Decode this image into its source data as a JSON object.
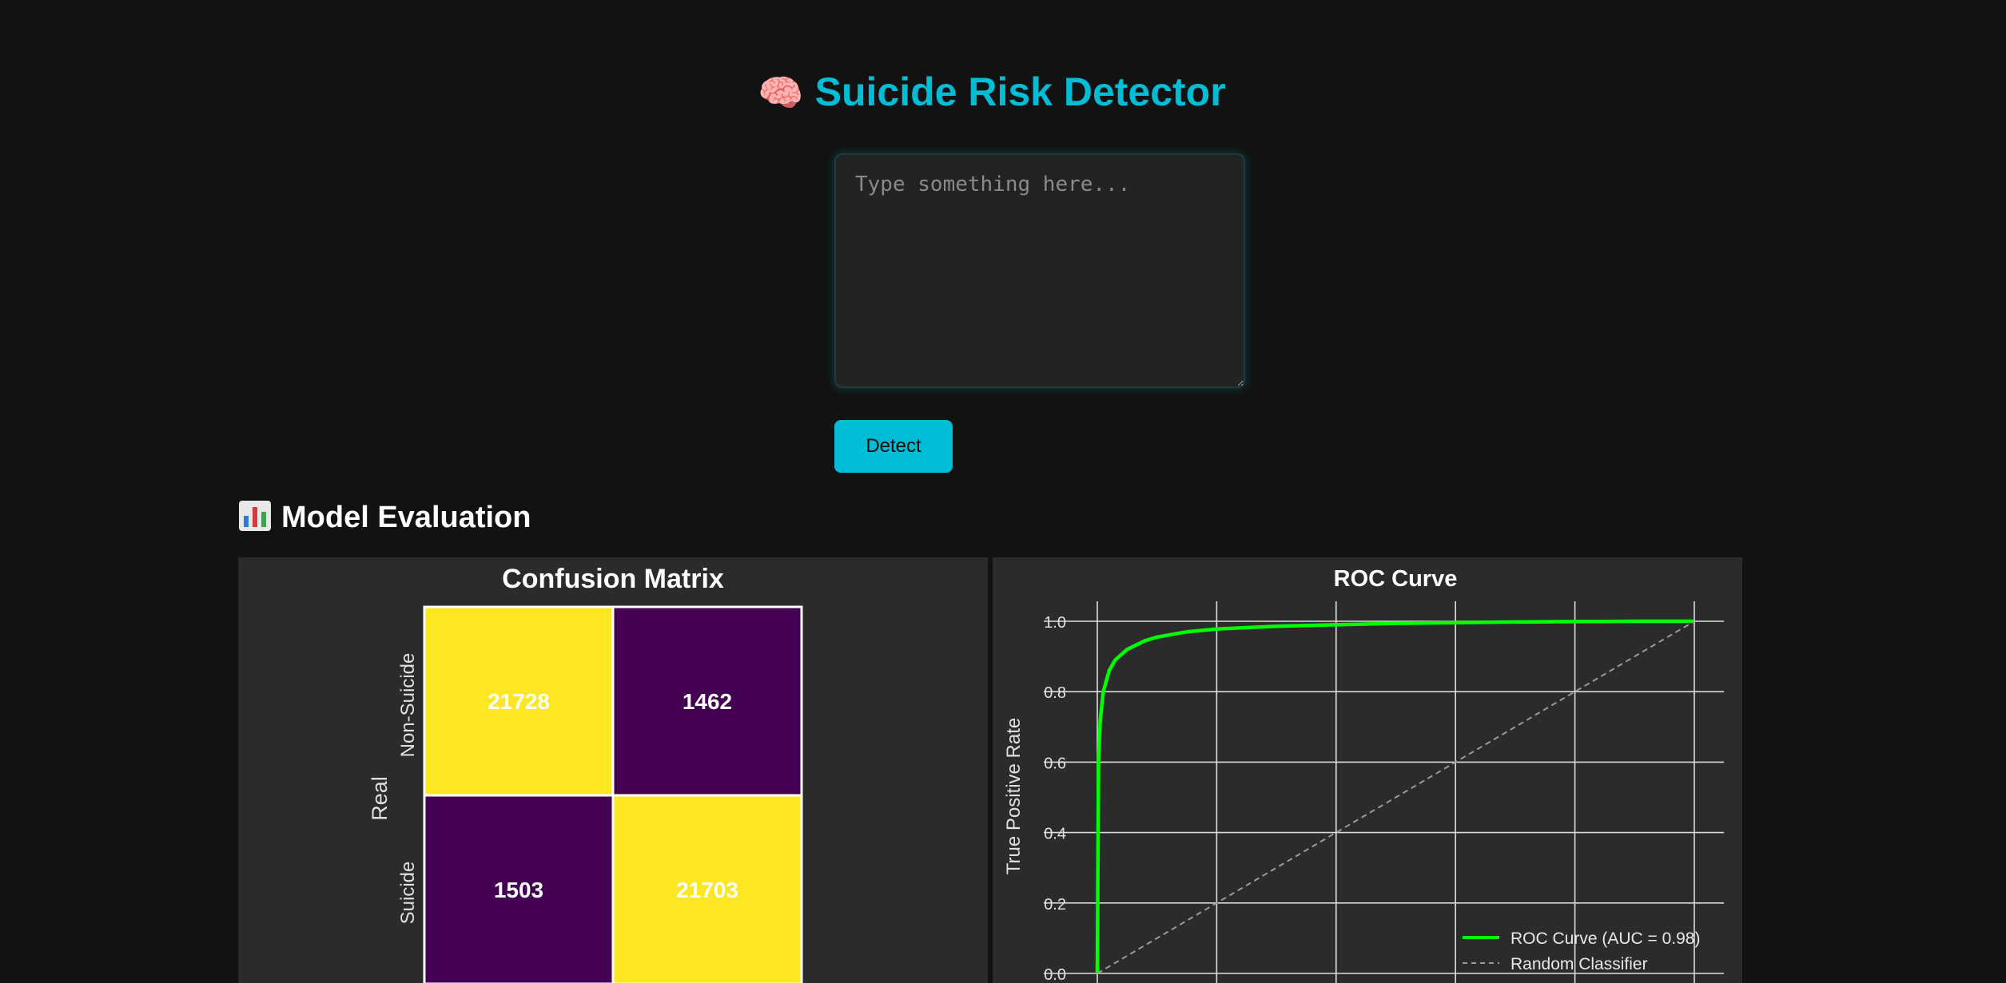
{
  "app": {
    "title": "Suicide Risk Detector",
    "title_icon": "brain-icon",
    "accent_color": "#00bcd4"
  },
  "input": {
    "placeholder": "Type something here...",
    "value": ""
  },
  "detect_button": {
    "label": "Detect"
  },
  "evaluation": {
    "title": "Model Evaluation",
    "icon": "bar-chart-icon"
  },
  "chart_data": [
    {
      "type": "heatmap",
      "title": "Confusion Matrix",
      "ylabel": "Real",
      "row_labels": [
        "Non-Suicide",
        "Suicide"
      ],
      "matrix": [
        [
          21728,
          1462
        ],
        [
          1503,
          21703
        ]
      ],
      "colormap": "viridis",
      "high_color": "#fde725",
      "low_color": "#440154"
    },
    {
      "type": "line",
      "title": "ROC Curve",
      "ylabel": "True Positive Rate",
      "xlim": [
        0,
        1
      ],
      "ylim": [
        0,
        1
      ],
      "yticks": [
        "0.0",
        "0.2",
        "0.4",
        "0.6",
        "0.8",
        "1.0"
      ],
      "grid": true,
      "legend_position": "bottom-right",
      "series": [
        {
          "name": "ROC Curve (AUC = 0.98)",
          "color": "#00ff00",
          "x": [
            0,
            0.002,
            0.005,
            0.01,
            0.02,
            0.03,
            0.05,
            0.08,
            0.1,
            0.15,
            0.2,
            0.3,
            0.4,
            0.5,
            0.6,
            0.7,
            0.8,
            0.9,
            1.0
          ],
          "y": [
            0,
            0.6,
            0.72,
            0.8,
            0.86,
            0.89,
            0.92,
            0.945,
            0.955,
            0.97,
            0.978,
            0.986,
            0.99,
            0.994,
            0.996,
            0.998,
            0.999,
            1.0,
            1.0
          ]
        },
        {
          "name": "Random Classifier",
          "color": "#9a9a9a",
          "dashed": true,
          "x": [
            0,
            1
          ],
          "y": [
            0,
            1
          ]
        }
      ]
    }
  ]
}
